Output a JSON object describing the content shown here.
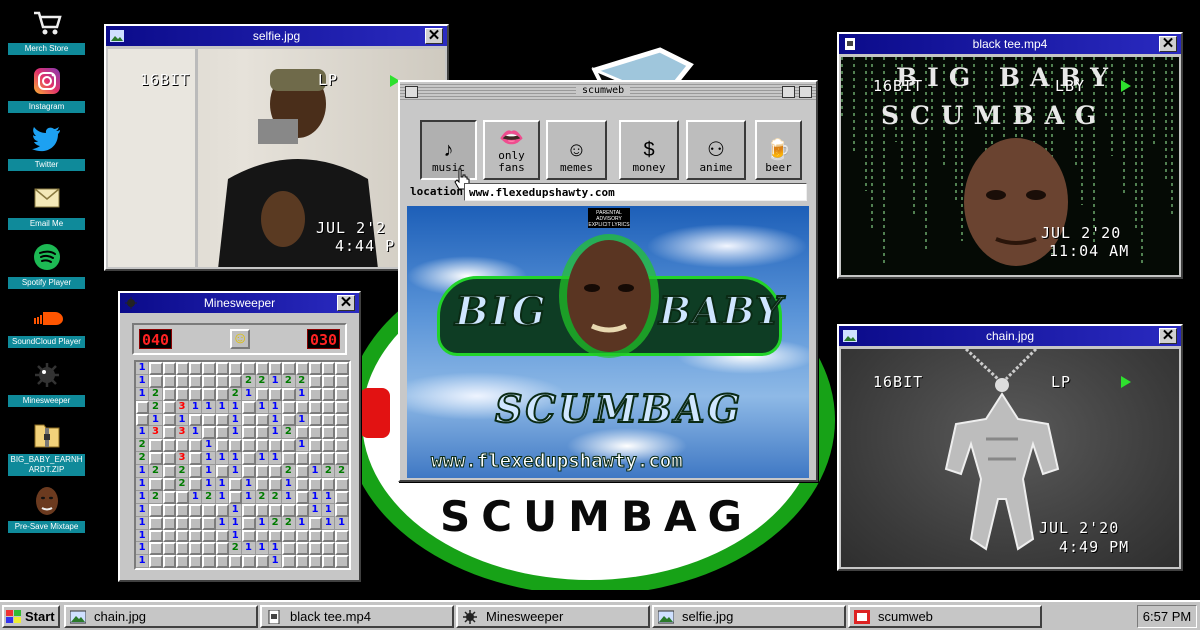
{
  "desktop_icons": [
    {
      "label": "Merch Store",
      "icon": "shopping-cart-icon"
    },
    {
      "label": "Instagram",
      "icon": "instagram-icon"
    },
    {
      "label": "Twitter",
      "icon": "twitter-icon"
    },
    {
      "label": "Email Me",
      "icon": "envelope-icon"
    },
    {
      "label": "Spotify Player",
      "icon": "spotify-icon"
    },
    {
      "label": "SoundCloud Player",
      "icon": "soundcloud-icon"
    },
    {
      "label": "Minesweeper",
      "icon": "mine-icon"
    },
    {
      "label": "BIG_BABY_EARNHARDT.ZIP",
      "icon": "zip-folder-icon"
    },
    {
      "label": "Pre-Save Mixtape",
      "icon": "face-icon"
    }
  ],
  "selfie_window": {
    "title": "selfie.jpg",
    "osd_left": "16BIT",
    "osd_right": "LP",
    "date": "JUL  2'2",
    "time": "4:44 P"
  },
  "video_window": {
    "title": "black tee.mp4",
    "overlay_line1": "BIG BABY",
    "overlay_line2": "SCUMBAG",
    "osd_left": "16BIT",
    "osd_right": "LBY",
    "date": "JUL  2'20",
    "time": "11:04 AM"
  },
  "chain_window": {
    "title": "chain.jpg",
    "osd_left": "16BIT",
    "osd_right": "LP",
    "date": "JUL  2'20",
    "time": "4:49 PM"
  },
  "minesweeper": {
    "title": "Minesweeper",
    "mines_left": "040",
    "timer": "030",
    "face": "☺",
    "grid": [
      "1HHHHHHHHHHHHHHH",
      "1HHHHHHH22122HHH",
      "12HHHHH21HHH1HHH",
      "H2H31111H11HHHHH",
      "H1H1HHH1HH1H1HHH",
      "13H31HH1HH12HHHH",
      "2HHHH1HHHHHH1HHH",
      "2HH3H111H11HHHHH",
      "12H2H1H1HHH2H122",
      "1HH2H11H1HH1HHHH",
      "12HH121H1221H11H",
      "1HHHHHH1HHHHH11H",
      "1HHHHH11H1221H11",
      "1HHHHHH1HHHHHHHH",
      "1HHHHHH2111HHHHH",
      "1HHHHHHHHH1HHHHH"
    ],
    "colors": {
      "1": "#0000ff",
      "2": "#007b00",
      "3": "#ff0000"
    }
  },
  "scumweb": {
    "title": "scumweb",
    "toolbar": [
      {
        "label": "music",
        "glyph": "♪",
        "icon": "music-note-icon"
      },
      {
        "label": "only fans",
        "glyph": "👄",
        "icon": "lips-icon"
      },
      {
        "label": "memes",
        "glyph": "☺",
        "icon": "troll-face-icon"
      },
      {
        "label": "money",
        "glyph": "$",
        "icon": "money-bag-icon"
      },
      {
        "label": "anime",
        "glyph": "⚇",
        "icon": "anime-face-icon"
      },
      {
        "label": "beer",
        "glyph": "🍺",
        "icon": "beer-mug-icon"
      }
    ],
    "location_label": "location:",
    "location_value": "www.flexedupshawty.com",
    "cover": {
      "advisory": "PARENTAL ADVISORY EXPLICIT LYRICS",
      "word1": "BIG",
      "word2": "BABY",
      "word3": "SCUMBAG",
      "url": "www.flexedupshawty.com"
    }
  },
  "background_text": "SCUMBAG",
  "taskbar": {
    "start": "Start",
    "items": [
      {
        "label": "chain.jpg",
        "icon": "image-icon"
      },
      {
        "label": "black tee.mp4",
        "icon": "video-file-icon"
      },
      {
        "label": "Minesweeper",
        "icon": "mine-icon"
      },
      {
        "label": "selfie.jpg",
        "icon": "image-icon"
      },
      {
        "label": "scumweb",
        "icon": "scumweb-icon"
      }
    ],
    "clock": "6:57 PM"
  },
  "colors": {
    "titlebar": "#0b0b8a",
    "desktop": "#000000",
    "icon_label": "#0f8a9a",
    "green_ring": "#1fb31f",
    "led_red": "#ff2222"
  }
}
